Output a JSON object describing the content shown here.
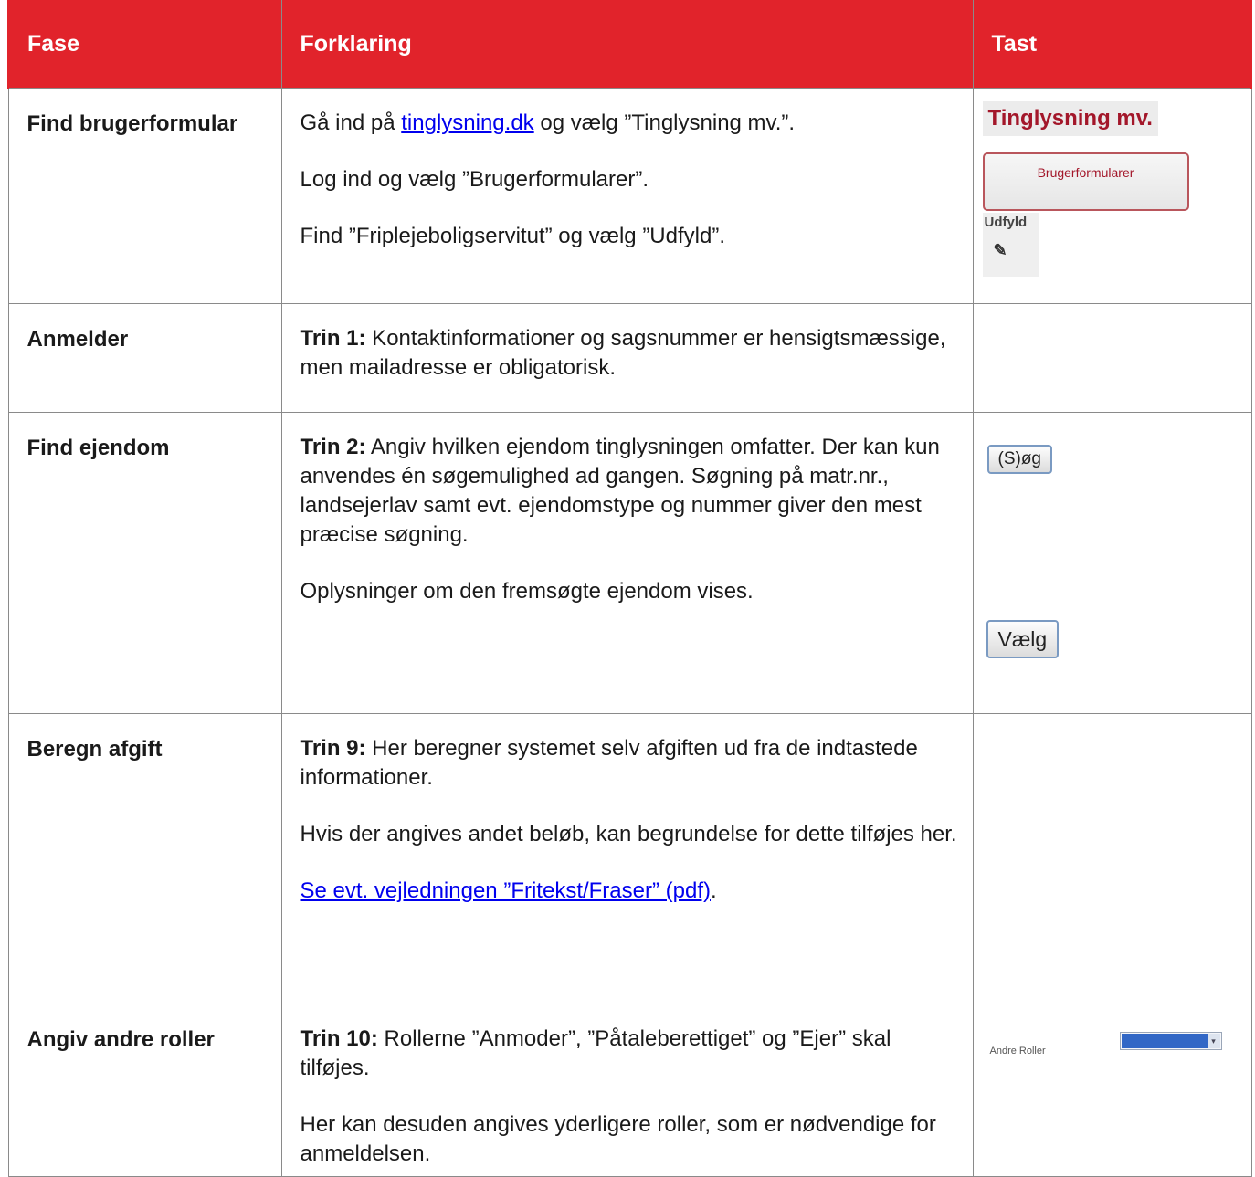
{
  "header": {
    "fase": "Fase",
    "forklaring": "Forklaring",
    "tast": "Tast"
  },
  "rows": [
    {
      "fase": "Find brugerformular",
      "forklaring": [
        {
          "pre": "Gå ind på ",
          "link": "tinglysning.dk",
          "post": " og vælg ”Tinglysning mv.”."
        },
        {
          "text": "Log ind og vælg ”Brugerformularer”."
        },
        {
          "text": "Find ”Friplejeboligservitut” og vælg ”Udfyld”."
        }
      ],
      "tast": {
        "tinglysning_label": "Tinglysning mv.",
        "brugerformularer_button": "Brugerformularer",
        "udfyld_label": "Udfyld",
        "pen_icon": "pencil-icon"
      }
    },
    {
      "fase": "Anmelder",
      "forklaring": [
        {
          "bold": "Trin 1:",
          "text": " Kontaktinformationer og sagsnummer er hensigtsmæssige, men mailadresse er obligatorisk."
        }
      ]
    },
    {
      "fase": "Find ejendom",
      "forklaring": [
        {
          "bold": "Trin 2:",
          "text": " Angiv hvilken ejendom tinglysningen omfatter. Der kan kun anvendes én søgemulighed ad gangen. Søgning på matr.nr., landsejerlav samt evt. ejendomstype og nummer giver den mest præcise søgning."
        },
        {
          "text": "Oplysninger om den fremsøgte ejendom vises."
        }
      ],
      "tast": {
        "sog_button": "(S)øg",
        "vaelg_button": "Vælg"
      }
    },
    {
      "fase": "Beregn afgift",
      "forklaring": [
        {
          "bold": "Trin 9:",
          "text": " Her beregner systemet selv afgiften ud fra de indtastede informationer."
        },
        {
          "text": "Hvis der angives andet beløb, kan begrundelse for dette tilføjes her."
        },
        {
          "link": "Se evt. vejledningen ”Fritekst/Fraser” (pdf)",
          "post": "."
        }
      ]
    },
    {
      "fase": "Angiv andre roller",
      "forklaring": [
        {
          "bold": "Trin 10:",
          "text": " Rollerne ”Anmoder”, ”Påtaleberettiget” og ”Ejer” skal tilføjes."
        },
        {
          "text": "Her kan desuden angives yderligere roller, som er nødvendige for anmeldelsen."
        }
      ],
      "tast": {
        "andre_roller_label": "Andre Roller",
        "select_color": "#3167c6"
      }
    }
  ]
}
